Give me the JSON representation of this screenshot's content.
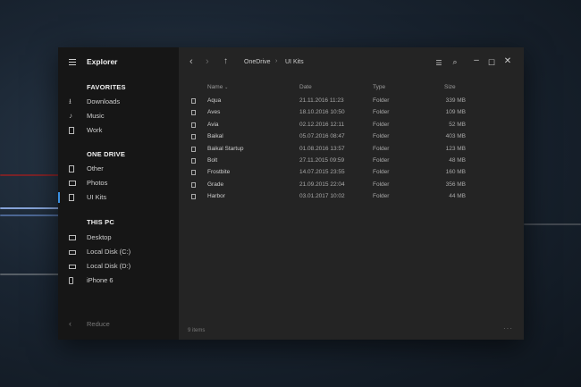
{
  "sidebar": {
    "app_title": "Explorer",
    "sections": {
      "favorites": "FAVORITES",
      "one_drive": "ONE DRIVE",
      "this_pc": "THIS PC"
    },
    "favorites": [
      {
        "label": "Downloads",
        "icon": "download-icon"
      },
      {
        "label": "Music",
        "icon": "music-icon"
      },
      {
        "label": "Work",
        "icon": "document-icon"
      }
    ],
    "one_drive": [
      {
        "label": "Other",
        "icon": "document-icon"
      },
      {
        "label": "Photos",
        "icon": "photo-icon"
      },
      {
        "label": "UI Kits",
        "icon": "document-icon",
        "active": true
      }
    ],
    "this_pc": [
      {
        "label": "Desktop",
        "icon": "monitor-icon"
      },
      {
        "label": "Local Disk (C:)",
        "icon": "drive-icon"
      },
      {
        "label": "Local Disk (D:)",
        "icon": "drive-icon"
      },
      {
        "label": "iPhone 6",
        "icon": "phone-icon"
      }
    ],
    "reduce_label": "Reduce"
  },
  "breadcrumb": [
    "OneDrive",
    "UI Kits"
  ],
  "columns": {
    "name": "Name",
    "date": "Date",
    "type": "Type",
    "size": "Size"
  },
  "files": [
    {
      "name": "Aqua",
      "date": "21.11.2016 11:23",
      "type": "Folder",
      "size": "339 MB"
    },
    {
      "name": "Aves",
      "date": "18.10.2016 10:50",
      "type": "Folder",
      "size": "109 MB"
    },
    {
      "name": "Avia",
      "date": "02.12.2016 12:11",
      "type": "Folder",
      "size": "52 MB"
    },
    {
      "name": "Baikal",
      "date": "05.07.2016 08:47",
      "type": "Folder",
      "size": "403 MB"
    },
    {
      "name": "Baikal Startup",
      "date": "01.08.2016 13:57",
      "type": "Folder",
      "size": "123 MB"
    },
    {
      "name": "Bolt",
      "date": "27.11.2015 09:59",
      "type": "Folder",
      "size": "48 MB"
    },
    {
      "name": "Frostbite",
      "date": "14.07.2015 23:55",
      "type": "Folder",
      "size": "160 MB"
    },
    {
      "name": "Grade",
      "date": "21.09.2015 22:04",
      "type": "Folder",
      "size": "356 MB"
    },
    {
      "name": "Harbor",
      "date": "03.01.2017 10:02",
      "type": "Folder",
      "size": "44 MB"
    }
  ],
  "status": "9 items",
  "colors": {
    "accent": "#3a8fe0",
    "window": "#242424",
    "sidebar": "#161616"
  }
}
